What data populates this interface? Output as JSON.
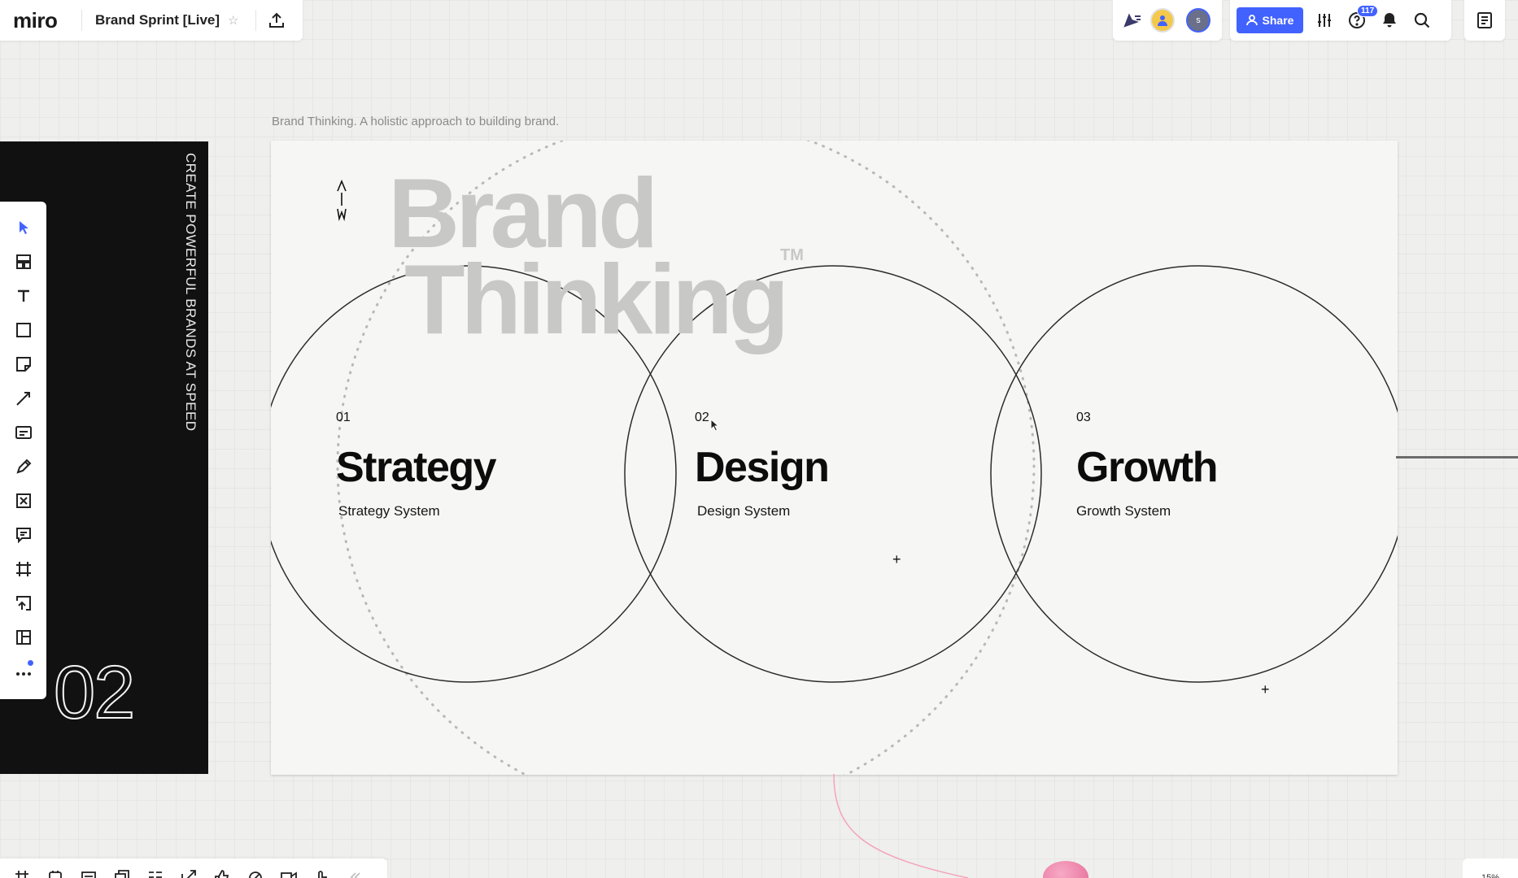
{
  "app": {
    "logo": "miro",
    "board_title": "Brand Sprint [Live]"
  },
  "header": {
    "share_label": "Share",
    "help_badge": "117",
    "avatar_initial": "s"
  },
  "canvas": {
    "frame_caption": "Brand Thinking. A holistic approach to building brand.",
    "side_frame": {
      "tagline": "CREATE POWERFUL BRANDS AT SPEED",
      "number": "02"
    },
    "slide": {
      "headline_line1": "Brand",
      "headline_line2": "Thinking",
      "trademark": "TM",
      "pillars": [
        {
          "number": "01",
          "title": "Strategy",
          "subtitle": "Strategy System"
        },
        {
          "number": "02",
          "title": "Design",
          "subtitle": "Design System"
        },
        {
          "number": "03",
          "title": "Growth",
          "subtitle": "Growth System"
        }
      ]
    }
  },
  "toolbar": {
    "tools": [
      "select-icon",
      "templates-icon",
      "text-icon",
      "shape-icon",
      "sticky-note-icon",
      "connection-line-icon",
      "card-icon",
      "pen-icon",
      "frame-cross-icon",
      "comment-icon",
      "frame-icon",
      "upload-icon",
      "kanban-icon",
      "more-icon"
    ]
  },
  "zoom": {
    "level": "15%"
  },
  "colors": {
    "accent": "#4262ff",
    "frame_black": "#111111",
    "headline_grey": "#c8c8c6",
    "connector_pink": "#f2a5b8"
  }
}
